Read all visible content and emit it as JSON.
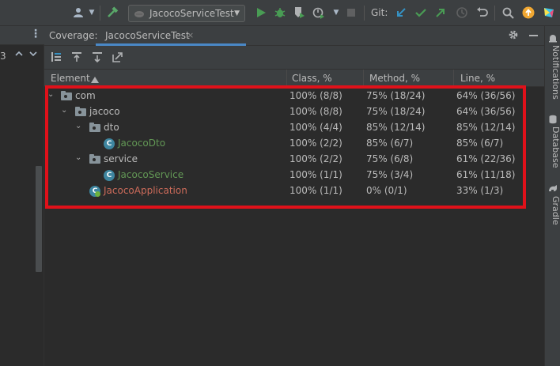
{
  "toolbar": {
    "run_config": "JacocoServiceTest",
    "git_label": "Git:",
    "icons": [
      "user-icon",
      "hammer-icon",
      "run-icon",
      "debug-icon",
      "coverage-icon",
      "profiler-icon",
      "stop-icon",
      "git-update-icon",
      "git-commit-icon",
      "git-push-icon",
      "history-icon",
      "rollback-icon",
      "search-icon",
      "update-icon",
      "jetbrains-icon"
    ]
  },
  "left_strip": {
    "line_number": "3"
  },
  "coverage": {
    "title": "Coverage:",
    "tab_label": "JacocoServiceTest",
    "close_glyph": "×",
    "columns": {
      "element": "Element",
      "class": "Class, %",
      "method": "Method, %",
      "line": "Line, %"
    },
    "rows": [
      {
        "name": "com",
        "class": "100% (8/8)",
        "method": "75% (18/24)",
        "line": "64% (36/56)"
      },
      {
        "name": "jacoco",
        "class": "100% (8/8)",
        "method": "75% (18/24)",
        "line": "64% (36/56)"
      },
      {
        "name": "dto",
        "class": "100% (4/4)",
        "method": "85% (12/14)",
        "line": "85% (12/14)"
      },
      {
        "name": "JacocoDto",
        "class": "100% (2/2)",
        "method": "85% (6/7)",
        "line": "85% (6/7)"
      },
      {
        "name": "service",
        "class": "100% (2/2)",
        "method": "75% (6/8)",
        "line": "61% (22/36)"
      },
      {
        "name": "JacocoService",
        "class": "100% (1/1)",
        "method": "75% (3/4)",
        "line": "61% (11/18)"
      },
      {
        "name": "JacocoApplication",
        "class": "100% (1/1)",
        "method": "0% (0/1)",
        "line": "33% (1/3)"
      }
    ]
  },
  "right_strip": {
    "tabs": [
      "Notifications",
      "Database",
      "Gradle"
    ]
  },
  "colors": {
    "accent": "#4a88c7",
    "highlight": "#e0111a",
    "covered_green": "#629755",
    "uncovered_red": "#cc6b5a"
  }
}
